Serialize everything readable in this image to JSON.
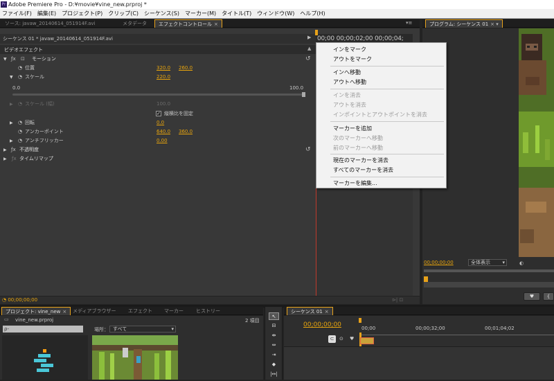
{
  "window": {
    "title": "Adobe Premiere Pro - D:¥movie¥vine_new.prproj *",
    "logo": "Pr"
  },
  "menubar": [
    "ファイル(F)",
    "編集(E)",
    "プロジェクト(P)",
    "クリップ(C)",
    "シーケンス(S)",
    "マーカー(M)",
    "タイトル(T)",
    "ウィンドウ(W)",
    "ヘルプ(H)"
  ],
  "source_tabs": [
    "ソース: javaw_20140614_051914F.avi",
    "メタデータ",
    "エフェクトコントロール"
  ],
  "effect_controls": {
    "clip_header": "シーケンス 01 * javaw_20140614_051914F.avi",
    "timecodes": "00;00  00;00;02;00  00;00;04;",
    "section_video": "ビデオエフェクト",
    "motion": "モーション",
    "position": {
      "label": "位置",
      "x": "320.0",
      "y": "260.0"
    },
    "scale": {
      "label": "スケール",
      "value": "220.0",
      "slider_min": "0.0",
      "slider_max": "100.0"
    },
    "scale_width": {
      "label": "スケール (幅)",
      "value": "100.0"
    },
    "uniform_scale": "縦横比を固定",
    "rotation": {
      "label": "回転",
      "value": "0.0"
    },
    "anchor": {
      "label": "アンカーポイント",
      "x": "640.0",
      "y": "360.0"
    },
    "anti_flicker": {
      "label": "アンチフリッカー",
      "value": "0.00"
    },
    "opacity": "不透明度",
    "time_remap": "タイムリマップ",
    "current_time": "00;00;00;00"
  },
  "program_monitor": {
    "tab": "プログラム: シーケンス 01",
    "timecode": "00;00;00;00",
    "zoom": "全体表示"
  },
  "context_menu": [
    {
      "label": "インをマーク",
      "enabled": true
    },
    {
      "label": "アウトをマーク",
      "enabled": true
    },
    {
      "sep": true
    },
    {
      "label": "インへ移動",
      "enabled": true
    },
    {
      "label": "アウトへ移動",
      "enabled": true
    },
    {
      "sep": true
    },
    {
      "label": "インを消去",
      "enabled": false
    },
    {
      "label": "アウトを消去",
      "enabled": false
    },
    {
      "label": "インポイントとアウトポイントを消去",
      "enabled": false
    },
    {
      "sep": true
    },
    {
      "label": "マーカーを追加",
      "enabled": true
    },
    {
      "label": "次のマーカーへ移動",
      "enabled": false
    },
    {
      "label": "前のマーカーへ移動",
      "enabled": false
    },
    {
      "sep": true
    },
    {
      "label": "現在のマーカーを消去",
      "enabled": true
    },
    {
      "label": "すべてのマーカーを消去",
      "enabled": true
    },
    {
      "sep": true
    },
    {
      "label": "マーカーを編集...",
      "enabled": true
    }
  ],
  "project_panel": {
    "tabs": [
      "プロジェクト: vine_new",
      "メディアブラウザー",
      "エフェクト",
      "マーカー",
      "ヒストリー"
    ],
    "file": "vine_new.prproj",
    "items_count": "2 項目",
    "search_placeholder": "ρ-",
    "location_label": "場所：",
    "location_value": "すべて"
  },
  "timeline": {
    "tab": "シーケンス 01",
    "timecode": "00;00;00;00",
    "ruler": [
      "00;00",
      "00;00;32;00",
      "00;01;04;02"
    ]
  }
}
